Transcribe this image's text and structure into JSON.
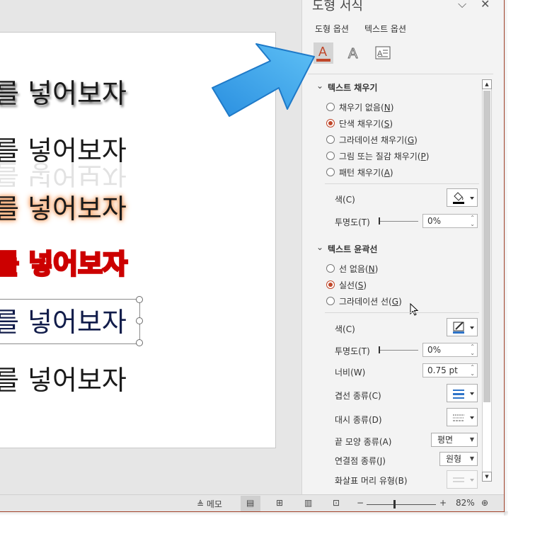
{
  "slide": {
    "lines": [
      "를 넣어보자",
      "를 넣어보자",
      "를 넣어보자",
      "를 넣어보자",
      "를 넣어보자",
      "를 넣어보자"
    ]
  },
  "pane": {
    "title": "도형 서식",
    "tabs": [
      "도형 옵션",
      "텍스트 옵션"
    ],
    "icon_tabs": [
      "text-fill-outline-icon",
      "text-effects-icon",
      "textbox-icon"
    ],
    "fill_section": {
      "title": "텍스트 채우기",
      "options": [
        {
          "label": "채우기 없음(",
          "key": "N",
          "end": ")",
          "selected": false
        },
        {
          "label": "단색 채우기(",
          "key": "S",
          "end": ")",
          "selected": true
        },
        {
          "label": "그라데이션 채우기(",
          "key": "G",
          "end": ")",
          "selected": false
        },
        {
          "label": "그림 또는 질감 채우기(",
          "key": "P",
          "end": ")",
          "selected": false
        },
        {
          "label": "패턴 채우기(",
          "key": "A",
          "end": ")",
          "selected": false
        }
      ],
      "color_label": "색(C)",
      "transparency_label": "투명도(T)",
      "transparency_value": "0%",
      "color_swatch": "#000000"
    },
    "outline_section": {
      "title": "텍스트 윤곽선",
      "options": [
        {
          "label": "선 없음(",
          "key": "N",
          "end": ")",
          "selected": false
        },
        {
          "label": "실선(",
          "key": "S",
          "end": ")",
          "selected": true
        },
        {
          "label": "그라데이션 선(",
          "key": "G",
          "end": ")",
          "selected": false
        }
      ],
      "color_label": "색(C)",
      "transparency_label": "투명도(T)",
      "transparency_value": "0%",
      "width_label": "너비(W)",
      "width_value": "0.75 pt",
      "compound_label": "겹선 종류(C)",
      "dash_label": "대시 종류(D)",
      "cap_label": "끝 모양 종류(A)",
      "cap_value": "평면",
      "join_label": "연결점 종류(J)",
      "join_value": "원형",
      "arrow_label": "화살표 머리 유형(B)",
      "color_swatch": "#2e74c8"
    }
  },
  "status_bar": {
    "notes_label": "메모",
    "zoom": "82%",
    "zoom_level": 0.82
  },
  "colors": {
    "accent": "#c0472a",
    "arrow": "#3aa8ea"
  }
}
